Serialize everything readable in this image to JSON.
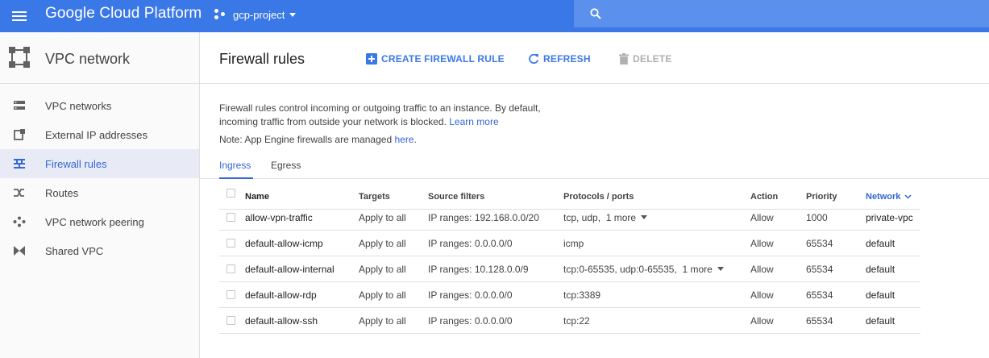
{
  "header": {
    "brand": "Google Cloud Platform",
    "project": "gcp-project",
    "accent": "#3b78e7"
  },
  "sidebar": {
    "title": "VPC network",
    "items": [
      {
        "label": "VPC networks",
        "icon": "vpc-networks-icon"
      },
      {
        "label": "External IP addresses",
        "icon": "external-ip-icon"
      },
      {
        "label": "Firewall rules",
        "icon": "firewall-icon",
        "active": true
      },
      {
        "label": "Routes",
        "icon": "routes-icon"
      },
      {
        "label": "VPC network peering",
        "icon": "peering-icon"
      },
      {
        "label": "Shared VPC",
        "icon": "shared-vpc-icon"
      }
    ]
  },
  "main": {
    "title": "Firewall rules",
    "toolbar": {
      "create": "CREATE FIREWALL RULE",
      "refresh": "REFRESH",
      "delete": "DELETE"
    },
    "description_1": "Firewall rules control incoming or outgoing traffic to an instance. By default,",
    "description_2": "incoming traffic from outside your network is blocked.",
    "learn_more": "Learn more",
    "note": "Note: App Engine firewalls are managed",
    "note_link": "here",
    "note_end": ".",
    "tabs": [
      "Ingress",
      "Egress"
    ],
    "table": {
      "headers": {
        "name": "Name",
        "targets": "Targets",
        "source": "Source filters",
        "protocols": "Protocols / ports",
        "action": "Action",
        "priority": "Priority",
        "network": "Network"
      },
      "rows": [
        {
          "name": "allow-vpn-traffic",
          "targets": "Apply to all",
          "source": "IP ranges: 192.168.0.0/20",
          "protocols": "tcp, udp,",
          "more": "1 more",
          "action": "Allow",
          "priority": "1000",
          "network": "private-vpc"
        },
        {
          "name": "default-allow-icmp",
          "targets": "Apply to all",
          "source": "IP ranges: 0.0.0.0/0",
          "protocols": "icmp",
          "more": "",
          "action": "Allow",
          "priority": "65534",
          "network": "default"
        },
        {
          "name": "default-allow-internal",
          "targets": "Apply to all",
          "source": "IP ranges: 10.128.0.0/9",
          "protocols": "tcp:0-65535, udp:0-65535,",
          "more": "1 more",
          "action": "Allow",
          "priority": "65534",
          "network": "default"
        },
        {
          "name": "default-allow-rdp",
          "targets": "Apply to all",
          "source": "IP ranges: 0.0.0.0/0",
          "protocols": "tcp:3389",
          "more": "",
          "action": "Allow",
          "priority": "65534",
          "network": "default"
        },
        {
          "name": "default-allow-ssh",
          "targets": "Apply to all",
          "source": "IP ranges: 0.0.0.0/0",
          "protocols": "tcp:22",
          "more": "",
          "action": "Allow",
          "priority": "65534",
          "network": "default"
        }
      ]
    }
  }
}
